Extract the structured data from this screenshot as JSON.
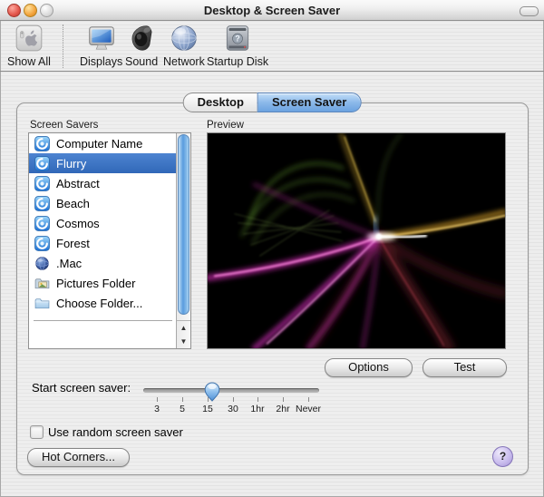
{
  "window": {
    "title": "Desktop & Screen Saver",
    "traffic_lights": [
      "close",
      "minimize",
      "zoom"
    ]
  },
  "toolbar": {
    "show_all_label": "Show All",
    "items": [
      {
        "label": "Displays",
        "icon": "displays-icon"
      },
      {
        "label": "Sound",
        "icon": "sound-icon"
      },
      {
        "label": "Network",
        "icon": "network-icon"
      },
      {
        "label": "Startup Disk",
        "icon": "startup-disk-icon"
      }
    ]
  },
  "tabs": [
    {
      "label": "Desktop",
      "active": false
    },
    {
      "label": "Screen Saver",
      "active": true
    }
  ],
  "screen_savers": {
    "section_label": "Screen Savers",
    "items": [
      {
        "name": "Computer Name",
        "icon": "swirl-icon",
        "selected": false
      },
      {
        "name": "Flurry",
        "icon": "swirl-icon",
        "selected": true
      },
      {
        "name": "Abstract",
        "icon": "swirl-icon",
        "selected": false
      },
      {
        "name": "Beach",
        "icon": "swirl-icon",
        "selected": false
      },
      {
        "name": "Cosmos",
        "icon": "swirl-icon",
        "selected": false
      },
      {
        "name": "Forest",
        "icon": "swirl-icon",
        "selected": false
      },
      {
        "name": ".Mac",
        "icon": "globe-icon",
        "selected": false
      },
      {
        "name": "Pictures Folder",
        "icon": "pictures-folder-icon",
        "selected": false
      },
      {
        "name": "Choose Folder...",
        "icon": "folder-icon",
        "selected": false
      }
    ]
  },
  "preview": {
    "section_label": "Preview",
    "content": "Flurry screen saver animation preview"
  },
  "actions": {
    "options": "Options",
    "test": "Test",
    "hot_corners": "Hot Corners...",
    "help": "?"
  },
  "slider": {
    "label": "Start screen saver:",
    "ticks": [
      "3",
      "5",
      "15",
      "30",
      "1hr",
      "2hr",
      "Never"
    ],
    "thumb_between": [
      "15",
      "30"
    ]
  },
  "random_checkbox": {
    "label": "Use random screen saver",
    "checked": false
  },
  "colors": {
    "selection_blue": "#3b76c8",
    "active_tab_blue": "#8cb9ea",
    "scrollbar_aqua": "#589bde",
    "help_purple": "#b2a3dc",
    "preview_bg": "#000000"
  }
}
